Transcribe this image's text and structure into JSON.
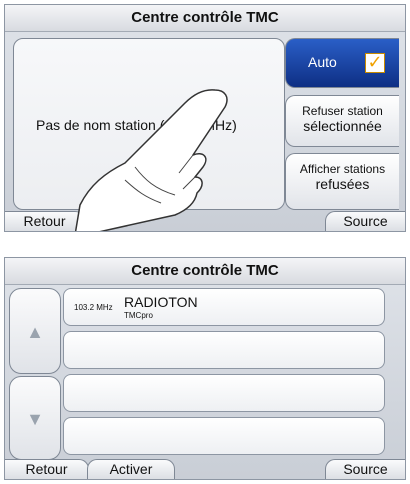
{
  "screen1": {
    "title": "Centre contrôle TMC",
    "station_text": "Pas de nom station (103.5 MHz)",
    "auto_button": {
      "label": "Auto",
      "checked": true
    },
    "reject_button": {
      "line1": "Refuser station",
      "line2": "sélectionnée"
    },
    "show_rejected_button": {
      "line1": "Afficher stations",
      "line2": "refusées"
    },
    "back_label": "Retour",
    "source_label": "Source"
  },
  "screen2": {
    "title": "Centre contrôle TMC",
    "stations": [
      {
        "freq": "103.2 MHz",
        "name": "RADIOTON",
        "sub": "TMCpro"
      },
      {
        "freq": "",
        "name": "",
        "sub": ""
      },
      {
        "freq": "",
        "name": "",
        "sub": ""
      },
      {
        "freq": "",
        "name": "",
        "sub": ""
      }
    ],
    "up_arrow": "▲",
    "down_arrow": "▼",
    "back_label": "Retour",
    "activate_label": "Activer",
    "source_label": "Source"
  },
  "colors": {
    "accent": "#1c47a8",
    "checkmark": "#f0a100"
  }
}
